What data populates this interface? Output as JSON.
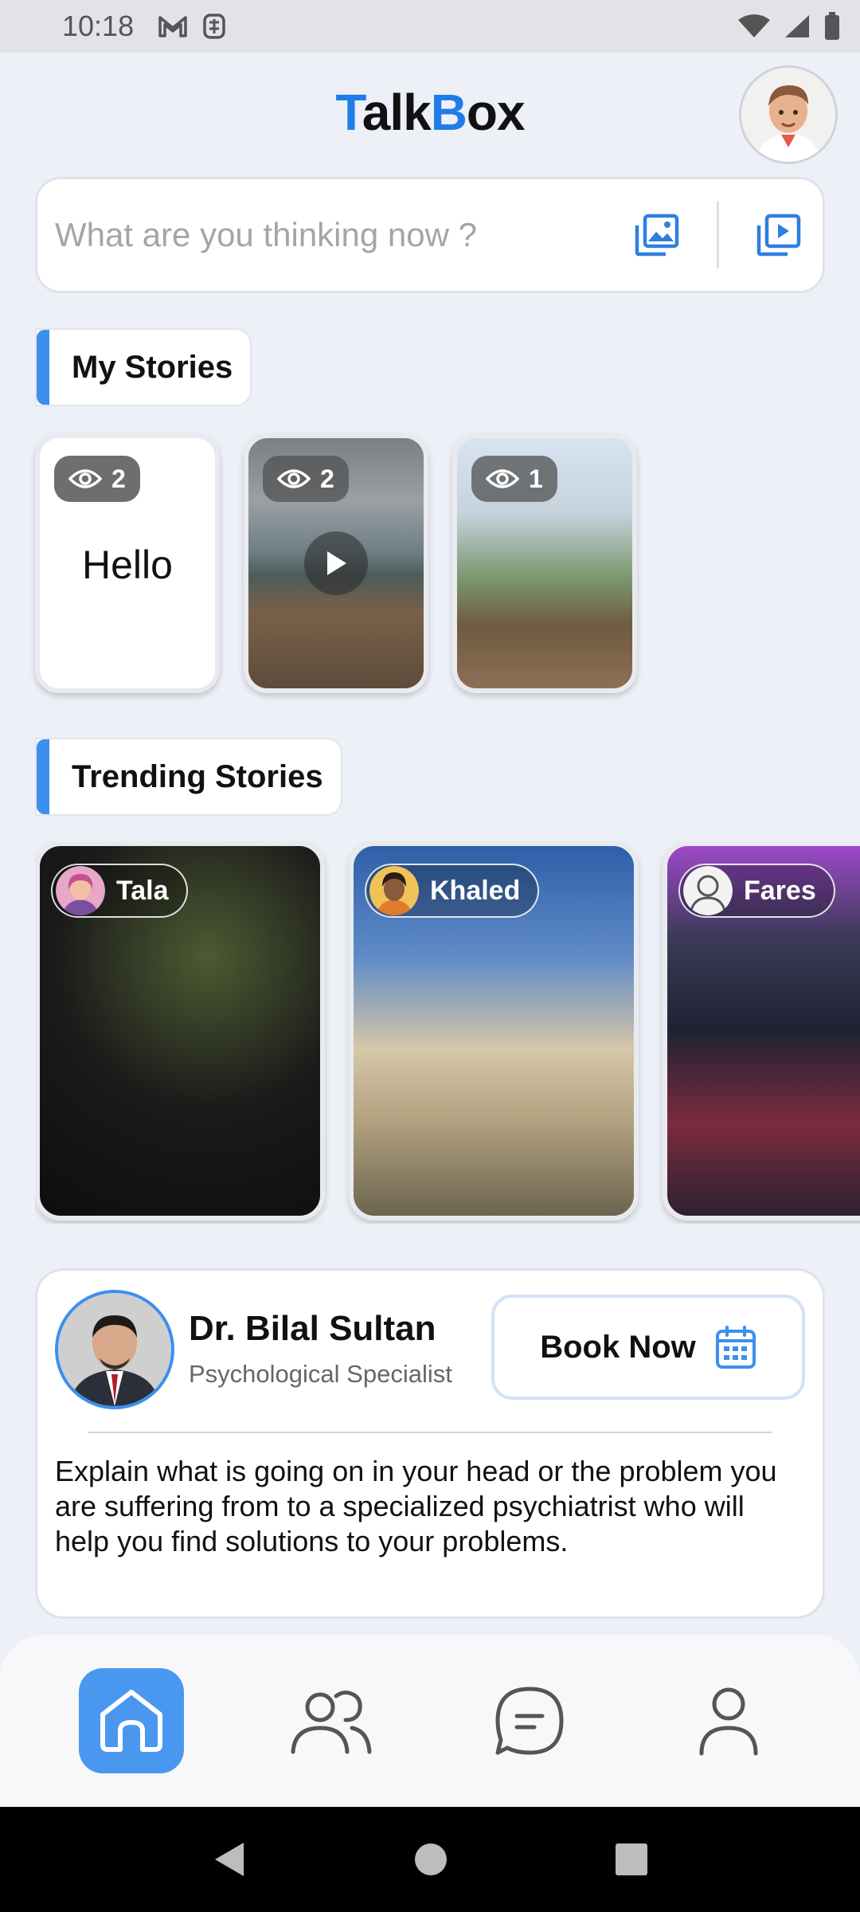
{
  "status_bar": {
    "time": "10:18",
    "left_icons": [
      "gmail-icon",
      "sim-icon"
    ],
    "right_icons": [
      "wifi-icon",
      "signal-icon",
      "battery-icon"
    ]
  },
  "header": {
    "logo_first_letter": "T",
    "logo_part_1": "alk",
    "logo_second_letter": "B",
    "logo_part_2": "ox",
    "accent_color": "#1f7de8"
  },
  "post_box": {
    "placeholder": "What are you thinking now ?",
    "image_button_icon": "image-icon",
    "video_button_icon": "video-icon"
  },
  "my_stories": {
    "title": "My Stories",
    "items": [
      {
        "type": "text",
        "views": "2",
        "text": "Hello"
      },
      {
        "type": "video",
        "views": "2"
      },
      {
        "type": "image",
        "views": "1"
      }
    ]
  },
  "trending": {
    "title": "Trending Stories",
    "items": [
      {
        "user": "Tala"
      },
      {
        "user": "Khaled"
      },
      {
        "user": "Fares"
      }
    ]
  },
  "doctor": {
    "name": "Dr. Bilal Sultan",
    "role": "Psychological Specialist",
    "book_label": "Book Now",
    "description": "Explain what is going on in your head or the problem you are suffering from to a specialized psychiatrist who will help you find solutions to your problems."
  },
  "bottom_nav": {
    "items": [
      "home-icon",
      "friends-icon",
      "chat-icon",
      "profile-icon"
    ],
    "active": "home-icon",
    "active_color": "#4a97f0"
  }
}
